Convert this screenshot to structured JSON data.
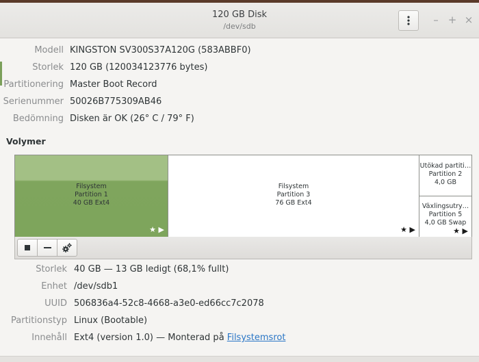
{
  "window": {
    "title": "120 GB Disk",
    "subtitle": "/dev/sdb",
    "minimize": "–",
    "maximize": "+",
    "close": "×"
  },
  "disk": {
    "props": [
      {
        "label": "Modell",
        "value": "KINGSTON SV300S37A120G (583ABBF0)"
      },
      {
        "label": "Storlek",
        "value": "120 GB (120034123776 bytes)"
      },
      {
        "label": "Partitionering",
        "value": "Master Boot Record"
      },
      {
        "label": "Serienummer",
        "value": "50026B775309AB46"
      },
      {
        "label": "Bedömning",
        "value": "Disken är OK (26° C / 79° F)"
      }
    ]
  },
  "volumes": {
    "title": "Volymer",
    "partition1": {
      "line1": "Filsystem",
      "line2": "Partition 1",
      "line3": "40 GB Ext4",
      "icons": "★ ▶",
      "selected": true
    },
    "partition3": {
      "line1": "Filsystem",
      "line2": "Partition 3",
      "line3": "76 GB Ext4",
      "icons": "★ ▶"
    },
    "partition2": {
      "line1": "Utökad partiti…",
      "line2": "Partition 2",
      "line3": "4,0 GB"
    },
    "partition5": {
      "line1": "Växlingsutry…",
      "line2": "Partition 5",
      "line3": "4,0 GB Swap",
      "icons": "★ ▶"
    }
  },
  "toolbar": {
    "stop_icon": "stop-icon",
    "delete_icon": "minus-icon",
    "settings_icon": "gears-icon"
  },
  "partition": {
    "props": [
      {
        "label": "Storlek",
        "value": "40 GB — 13 GB ledigt (68,1% fullt)"
      },
      {
        "label": "Enhet",
        "value": "/dev/sdb1"
      },
      {
        "label": "UUID",
        "value": "506836a4-52c8-4668-a3e0-ed66cc7c2078"
      },
      {
        "label": "Partitionstyp",
        "value": "Linux (Bootable)"
      },
      {
        "label": "Innehåll",
        "value": "Ext4 (version 1.0) — Monterad på ",
        "link": "Filsystemsrot"
      }
    ]
  },
  "colors": {
    "selected_partition": "#7ea55c",
    "link": "#2a76c6"
  }
}
